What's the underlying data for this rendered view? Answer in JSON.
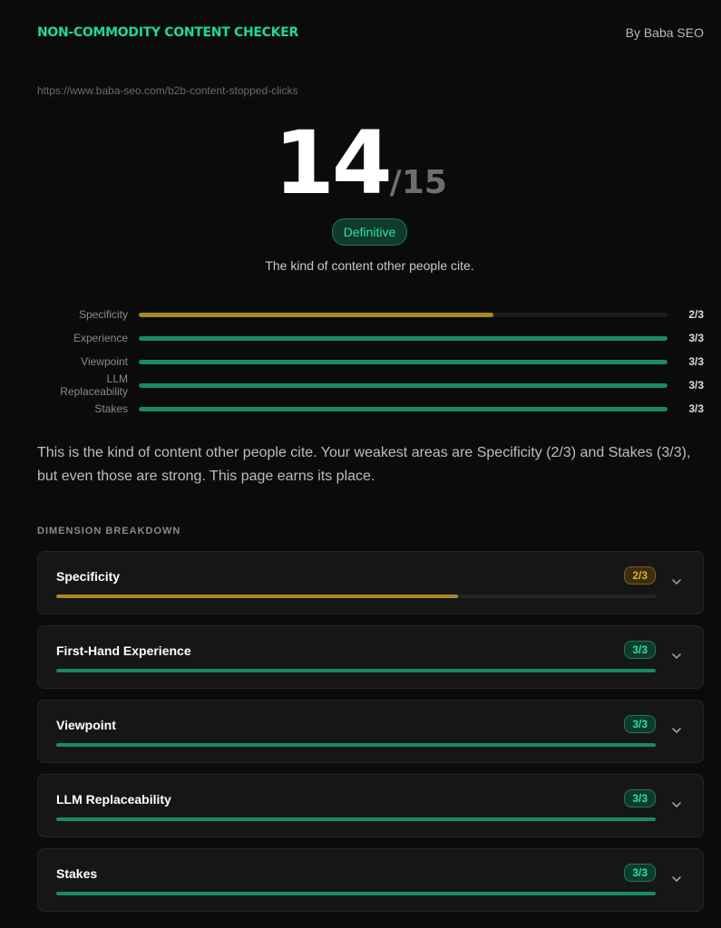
{
  "header": {
    "title": "NON-COMMODITY CONTENT CHECKER",
    "byline": "By Baba SEO"
  },
  "url": "https://www.baba-seo.com/b2b-content-stopped-clicks",
  "score": {
    "value": "14",
    "max": "/15"
  },
  "verdict": {
    "label": "Definitive",
    "tagline": "The kind of content other people cite."
  },
  "colors": {
    "accent": "#1fd6a3",
    "amber": "#a68a2a",
    "green": "#198a66"
  },
  "summary": [
    {
      "label": "Specificity",
      "value": "2/3",
      "fraction": 0.67,
      "color": "#a68a2a"
    },
    {
      "label": "Experience",
      "value": "3/3",
      "fraction": 1,
      "color": "#198a66"
    },
    {
      "label": "Viewpoint",
      "value": "3/3",
      "fraction": 1,
      "color": "#198a66"
    },
    {
      "label": "LLM Replaceability",
      "value": "3/3",
      "fraction": 1,
      "color": "#198a66"
    },
    {
      "label": "Stakes",
      "value": "3/3",
      "fraction": 1,
      "color": "#198a66"
    }
  ],
  "paragraph": "This is the kind of content other people cite. Your weakest areas are Specificity (2/3) and Stakes (3/3), but even those are strong. This page earns its place.",
  "breakdown": {
    "title": "DIMENSION BREAKDOWN",
    "items": [
      {
        "title": "Specificity",
        "score": "2/3",
        "fraction": 0.67,
        "tone": "amber",
        "color": "#a68a2a",
        "icon": "chevron-down-icon"
      },
      {
        "title": "First-Hand Experience",
        "score": "3/3",
        "fraction": 1,
        "tone": "green",
        "color": "#198a66",
        "icon": "chevron-down-icon"
      },
      {
        "title": "Viewpoint",
        "score": "3/3",
        "fraction": 1,
        "tone": "green",
        "color": "#198a66",
        "icon": "chevron-down-icon"
      },
      {
        "title": "LLM Replaceability",
        "score": "3/3",
        "fraction": 1,
        "tone": "green",
        "color": "#198a66",
        "icon": "chevron-down-icon"
      },
      {
        "title": "Stakes",
        "score": "3/3",
        "fraction": 1,
        "tone": "green",
        "color": "#198a66",
        "icon": "chevron-down-icon"
      }
    ]
  }
}
